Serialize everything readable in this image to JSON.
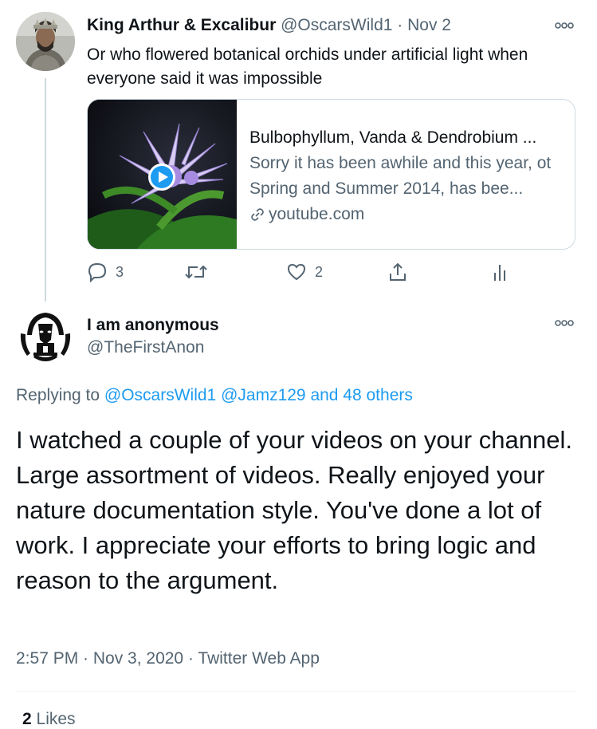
{
  "tweet1": {
    "author_name": "King Arthur & Excalibur",
    "author_handle": "@OscarsWild1",
    "separator": "·",
    "date": "Nov 2",
    "text": "Or who flowered botanical orchids under artificial light when everyone said it was impossible",
    "card": {
      "title": "Bulbophyllum, Vanda & Dendrobium ...",
      "description": "Sorry it has been awhile and this year, ot Spring and Summer 2014, has bee...",
      "domain": "youtube.com"
    },
    "actions": {
      "reply_count": "3",
      "retweet_count": "",
      "like_count": "2"
    }
  },
  "tweet2": {
    "author_name": "I am anonymous",
    "author_handle": "@TheFirstAnon",
    "replying_prefix": "Replying to",
    "replying_users": "@OscarsWild1 @Jamz129 and 48 others",
    "text": "I watched a couple of your videos on your channel. Large assortment of videos. Really enjoyed your nature documentation style. You've done a lot of work. I appreciate your efforts to bring logic and reason to the argument.",
    "timestamp": "2:57 PM · Nov 3, 2020 · Twitter Web App",
    "likes_count": "2",
    "likes_label": "Likes"
  },
  "colors": {
    "accent": "#1d9bf0",
    "muted_text": "#536471",
    "primary_text": "#0f1419",
    "border": "#cfd9de"
  },
  "icons": {
    "reply": "reply-icon",
    "retweet": "retweet-icon",
    "like": "heart-icon",
    "share": "share-icon",
    "analytics": "analytics-icon",
    "more": "more-icon",
    "play": "play-icon",
    "link": "link-icon"
  }
}
